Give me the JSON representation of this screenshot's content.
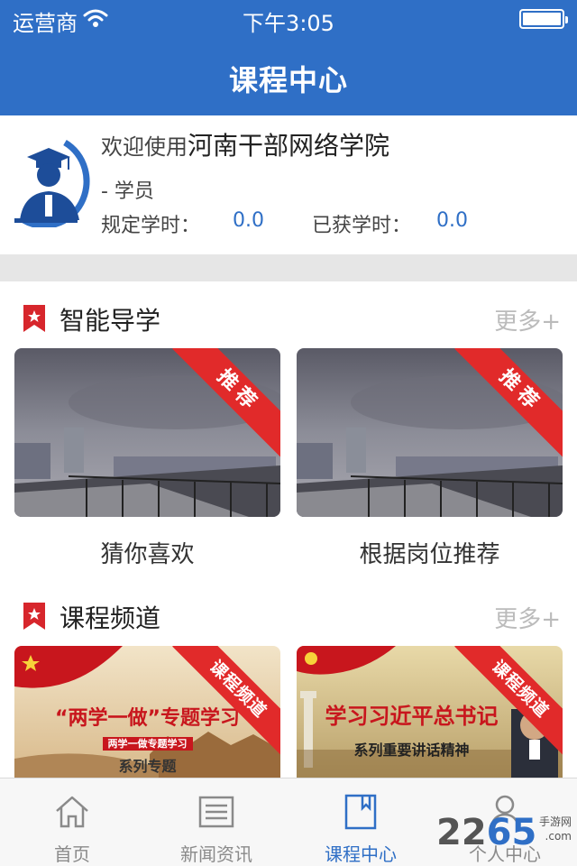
{
  "status_bar": {
    "carrier": "运营商",
    "time": "下午3:05"
  },
  "nav": {
    "title": "课程中心"
  },
  "profile": {
    "welcome_prefix": "欢迎使用",
    "school_name": "河南干部网络学院",
    "role": "- 学员",
    "required_hours_label": "规定学时：",
    "required_hours_value": "0.0",
    "earned_hours_label": "已获学时：",
    "earned_hours_value": "0.0"
  },
  "sections": [
    {
      "title": "智能导学",
      "more": "更多+",
      "cards": [
        {
          "label": "猜你喜欢",
          "ribbon": "推荐"
        },
        {
          "label": "根据岗位推荐",
          "ribbon": "推荐"
        }
      ]
    },
    {
      "title": "课程频道",
      "more": "更多+",
      "cards": [
        {
          "ribbon": "课程频道",
          "banner_title": "“两学一做”专题学习",
          "banner_small": "两学一做专题学习",
          "banner_sub": "系列专题"
        },
        {
          "ribbon": "课程频道",
          "banner_title": "学习习近平总书记",
          "banner_sub": "系列重要讲话精神"
        }
      ]
    }
  ],
  "tabbar": {
    "items": [
      {
        "label": "首页",
        "icon": "home-icon"
      },
      {
        "label": "新闻资讯",
        "icon": "news-icon"
      },
      {
        "label": "课程中心",
        "icon": "book-icon",
        "active": true
      },
      {
        "label": "个人中心",
        "icon": "person-icon"
      }
    ]
  },
  "watermark": {
    "text_a": "22",
    "text_b": "65",
    "sub": "手游网",
    "url": ".com"
  },
  "colors": {
    "primary": "#2f6fc6",
    "ribbon": "#e12a2a",
    "muted": "#bbbbbb"
  }
}
